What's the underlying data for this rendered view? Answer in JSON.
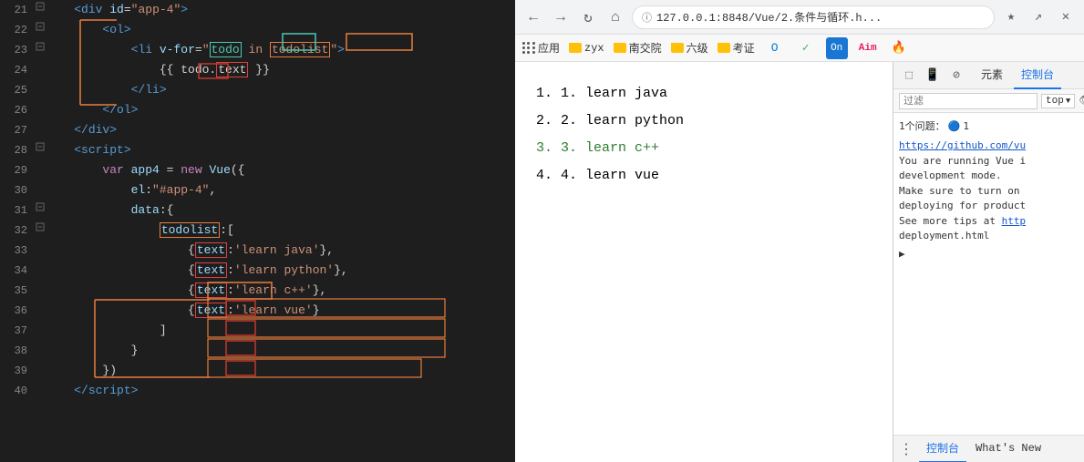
{
  "editor": {
    "lines": [
      {
        "num": 21,
        "fold": "□",
        "tokens": [
          {
            "t": "    ",
            "c": ""
          },
          {
            "t": "<",
            "c": "tag"
          },
          {
            "t": "div",
            "c": "tag"
          },
          {
            "t": " ",
            "c": ""
          },
          {
            "t": "id",
            "c": "attr"
          },
          {
            "t": "=",
            "c": "punct"
          },
          {
            "t": "\"app-4\"",
            "c": "val"
          },
          {
            "t": ">",
            "c": "tag"
          }
        ]
      },
      {
        "num": 22,
        "fold": "□",
        "tokens": [
          {
            "t": "        ",
            "c": ""
          },
          {
            "t": "<",
            "c": "tag"
          },
          {
            "t": "ol",
            "c": "tag"
          },
          {
            "t": ">",
            "c": "tag"
          }
        ]
      },
      {
        "num": 23,
        "fold": "□",
        "tokens": [
          {
            "t": "            ",
            "c": ""
          },
          {
            "t": "<",
            "c": "tag"
          },
          {
            "t": "li",
            "c": "tag"
          },
          {
            "t": " ",
            "c": ""
          },
          {
            "t": "v-for",
            "c": "attr"
          },
          {
            "t": "=",
            "c": "punct"
          },
          {
            "t": "\"",
            "c": "val"
          },
          {
            "t": "todo",
            "c": "box-green-text"
          },
          {
            "t": " in ",
            "c": "val"
          },
          {
            "t": "todolist",
            "c": "box-orange-text"
          },
          {
            "t": "\"",
            "c": "val"
          },
          {
            "t": ">",
            "c": "tag"
          }
        ]
      },
      {
        "num": 24,
        "tokens": [
          {
            "t": "                ",
            "c": ""
          },
          {
            "t": "{{ todo.",
            "c": "punct"
          },
          {
            "t": "text",
            "c": "box-red-text"
          },
          {
            "t": " }}",
            "c": "punct"
          }
        ]
      },
      {
        "num": 25,
        "tokens": [
          {
            "t": "            ",
            "c": ""
          },
          {
            "t": "</",
            "c": "tag"
          },
          {
            "t": "li",
            "c": "tag"
          },
          {
            "t": ">",
            "c": "tag"
          }
        ]
      },
      {
        "num": 26,
        "tokens": [
          {
            "t": "        ",
            "c": ""
          },
          {
            "t": "</",
            "c": "tag"
          },
          {
            "t": "ol",
            "c": "tag"
          },
          {
            "t": ">",
            "c": "tag"
          }
        ]
      },
      {
        "num": 27,
        "tokens": [
          {
            "t": "    ",
            "c": ""
          },
          {
            "t": "</",
            "c": "tag"
          },
          {
            "t": "div",
            "c": "tag"
          },
          {
            "t": ">",
            "c": "tag"
          }
        ]
      },
      {
        "num": 28,
        "fold": "□",
        "tokens": [
          {
            "t": "    ",
            "c": ""
          },
          {
            "t": "<",
            "c": "tag"
          },
          {
            "t": "script",
            "c": "tag"
          },
          {
            "t": ">",
            "c": "tag"
          }
        ]
      },
      {
        "num": 29,
        "tokens": [
          {
            "t": "        ",
            "c": ""
          },
          {
            "t": "var",
            "c": "keyword"
          },
          {
            "t": " app4 ",
            "c": "varname"
          },
          {
            "t": "= ",
            "c": "punct"
          },
          {
            "t": "new",
            "c": "keyword"
          },
          {
            "t": " ",
            "c": ""
          },
          {
            "t": "Vue",
            "c": "varname"
          },
          {
            "t": "({",
            "c": "punct"
          }
        ]
      },
      {
        "num": 30,
        "tokens": [
          {
            "t": "            ",
            "c": ""
          },
          {
            "t": "el",
            "c": "prop-color"
          },
          {
            "t": ":",
            "c": "punct"
          },
          {
            "t": "\"#app-4\"",
            "c": "string-color"
          },
          {
            "t": ",",
            "c": "punct"
          }
        ]
      },
      {
        "num": 31,
        "fold": "□",
        "tokens": [
          {
            "t": "            ",
            "c": ""
          },
          {
            "t": "data",
            "c": "prop-color"
          },
          {
            "t": ":{",
            "c": "punct"
          }
        ]
      },
      {
        "num": 32,
        "fold": "□",
        "tokens": [
          {
            "t": "                ",
            "c": ""
          },
          {
            "t": "todolist",
            "c": "box-orange-prop"
          },
          {
            "t": ":[",
            "c": "punct"
          }
        ]
      },
      {
        "num": 33,
        "tokens": [
          {
            "t": "                    ",
            "c": ""
          },
          {
            "t": "{",
            "c": "box-obj-start"
          },
          {
            "t": "text",
            "c": "box-red-key"
          },
          {
            "t": ":",
            "c": "punct"
          },
          {
            "t": "'learn java'",
            "c": "string-color"
          },
          {
            "t": "},",
            "c": "punct"
          }
        ]
      },
      {
        "num": 34,
        "tokens": [
          {
            "t": "                    ",
            "c": ""
          },
          {
            "t": "{",
            "c": "box-obj-start"
          },
          {
            "t": "text",
            "c": "box-red-key"
          },
          {
            "t": ":",
            "c": "punct"
          },
          {
            "t": "'learn python'",
            "c": "string-color"
          },
          {
            "t": "},",
            "c": "punct"
          }
        ]
      },
      {
        "num": 35,
        "tokens": [
          {
            "t": "                    ",
            "c": ""
          },
          {
            "t": "{",
            "c": "box-obj-start"
          },
          {
            "t": "text",
            "c": "box-red-key"
          },
          {
            "t": ":",
            "c": "punct"
          },
          {
            "t": "'learn c++'",
            "c": "string-color"
          },
          {
            "t": "},",
            "c": "punct"
          }
        ]
      },
      {
        "num": 36,
        "tokens": [
          {
            "t": "                    ",
            "c": ""
          },
          {
            "t": "{",
            "c": "box-obj-start"
          },
          {
            "t": "text",
            "c": "box-red-key"
          },
          {
            "t": ":",
            "c": "punct"
          },
          {
            "t": "'learn vue'",
            "c": "string-color"
          },
          {
            "t": "}",
            "c": "punct"
          }
        ]
      },
      {
        "num": 37,
        "tokens": [
          {
            "t": "                ",
            "c": ""
          },
          {
            "t": "]",
            "c": "punct"
          }
        ]
      },
      {
        "num": 38,
        "tokens": [
          {
            "t": "            ",
            "c": ""
          },
          {
            "t": "}",
            "c": "punct"
          }
        ]
      },
      {
        "num": 39,
        "tokens": [
          {
            "t": "        ",
            "c": ""
          },
          {
            "t": "})",
            "c": "punct"
          }
        ]
      },
      {
        "num": 40,
        "tokens": [
          {
            "t": "    ",
            "c": ""
          },
          {
            "t": "</",
            "c": "tag"
          },
          {
            "t": "script",
            "c": "tag"
          },
          {
            "t": ">",
            "c": "tag"
          }
        ]
      }
    ]
  },
  "browser": {
    "url": "127.0.0.1:8848/Vue/2.条件与循环.h...",
    "bookmarks": [
      "应用",
      "zyx",
      "南交院",
      "六级",
      "考证"
    ],
    "page_items": [
      "1. learn java",
      "2. learn python",
      "3. learn c++",
      "4. learn vue"
    ]
  },
  "devtools": {
    "tabs": [
      "元素",
      "控制台"
    ],
    "active_tab": "元素",
    "filter_placeholder": "过滤",
    "top_label": "top",
    "issues_label": "1个问题：",
    "issues_count": "1",
    "console_link": "https://github.com/vu",
    "console_text": "You are running Vue i\ndevelopment mode.\nMake sure to turn on\ndeploying for product\nSee more tips at http\ndeployment.html",
    "arrow_symbol": "▶",
    "bottom_tabs": [
      "控制台",
      "What's New"
    ]
  }
}
